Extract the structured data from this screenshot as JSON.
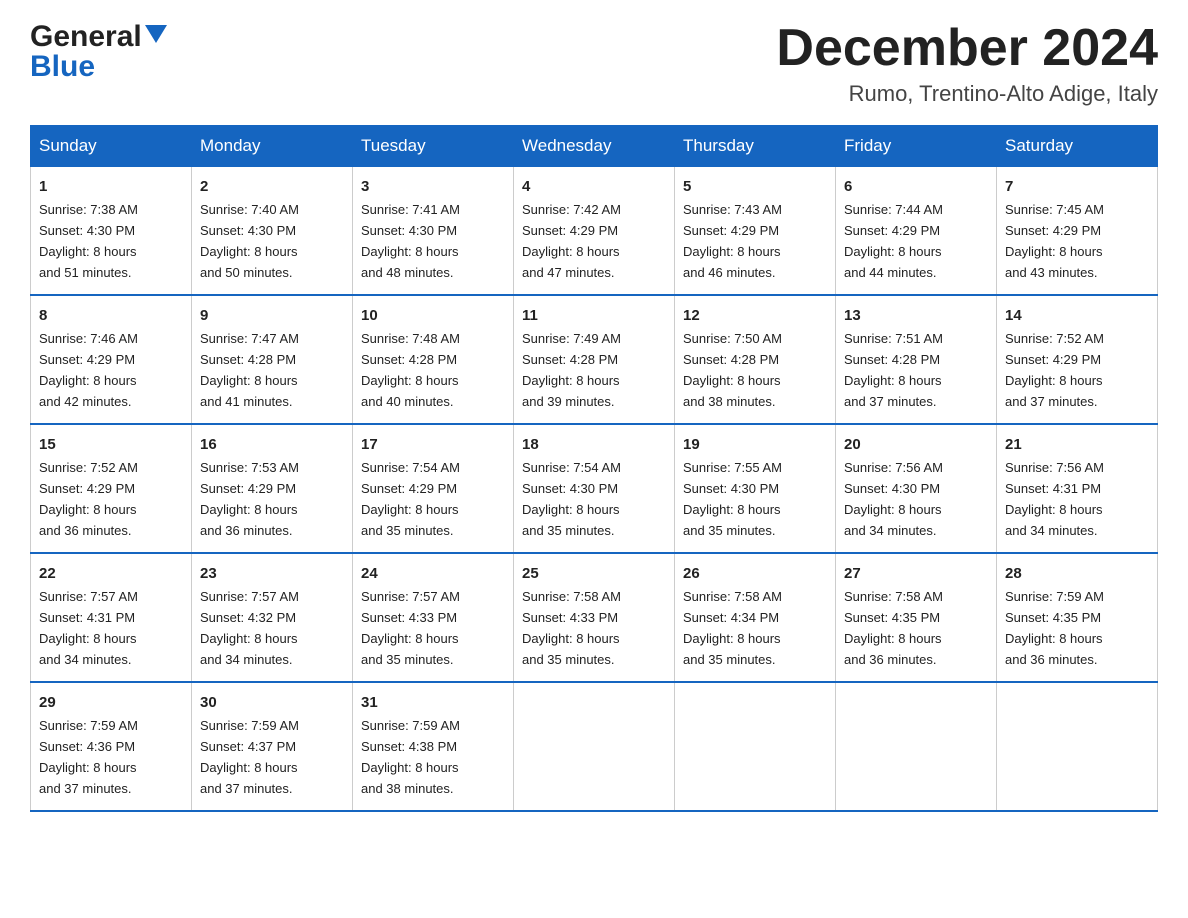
{
  "header": {
    "logo_general": "General",
    "logo_blue": "Blue",
    "month": "December 2024",
    "location": "Rumo, Trentino-Alto Adige, Italy"
  },
  "days_of_week": [
    "Sunday",
    "Monday",
    "Tuesday",
    "Wednesday",
    "Thursday",
    "Friday",
    "Saturday"
  ],
  "weeks": [
    [
      {
        "num": "1",
        "sunrise": "7:38 AM",
        "sunset": "4:30 PM",
        "daylight": "8 hours and 51 minutes."
      },
      {
        "num": "2",
        "sunrise": "7:40 AM",
        "sunset": "4:30 PM",
        "daylight": "8 hours and 50 minutes."
      },
      {
        "num": "3",
        "sunrise": "7:41 AM",
        "sunset": "4:30 PM",
        "daylight": "8 hours and 48 minutes."
      },
      {
        "num": "4",
        "sunrise": "7:42 AM",
        "sunset": "4:29 PM",
        "daylight": "8 hours and 47 minutes."
      },
      {
        "num": "5",
        "sunrise": "7:43 AM",
        "sunset": "4:29 PM",
        "daylight": "8 hours and 46 minutes."
      },
      {
        "num": "6",
        "sunrise": "7:44 AM",
        "sunset": "4:29 PM",
        "daylight": "8 hours and 44 minutes."
      },
      {
        "num": "7",
        "sunrise": "7:45 AM",
        "sunset": "4:29 PM",
        "daylight": "8 hours and 43 minutes."
      }
    ],
    [
      {
        "num": "8",
        "sunrise": "7:46 AM",
        "sunset": "4:29 PM",
        "daylight": "8 hours and 42 minutes."
      },
      {
        "num": "9",
        "sunrise": "7:47 AM",
        "sunset": "4:28 PM",
        "daylight": "8 hours and 41 minutes."
      },
      {
        "num": "10",
        "sunrise": "7:48 AM",
        "sunset": "4:28 PM",
        "daylight": "8 hours and 40 minutes."
      },
      {
        "num": "11",
        "sunrise": "7:49 AM",
        "sunset": "4:28 PM",
        "daylight": "8 hours and 39 minutes."
      },
      {
        "num": "12",
        "sunrise": "7:50 AM",
        "sunset": "4:28 PM",
        "daylight": "8 hours and 38 minutes."
      },
      {
        "num": "13",
        "sunrise": "7:51 AM",
        "sunset": "4:28 PM",
        "daylight": "8 hours and 37 minutes."
      },
      {
        "num": "14",
        "sunrise": "7:52 AM",
        "sunset": "4:29 PM",
        "daylight": "8 hours and 37 minutes."
      }
    ],
    [
      {
        "num": "15",
        "sunrise": "7:52 AM",
        "sunset": "4:29 PM",
        "daylight": "8 hours and 36 minutes."
      },
      {
        "num": "16",
        "sunrise": "7:53 AM",
        "sunset": "4:29 PM",
        "daylight": "8 hours and 36 minutes."
      },
      {
        "num": "17",
        "sunrise": "7:54 AM",
        "sunset": "4:29 PM",
        "daylight": "8 hours and 35 minutes."
      },
      {
        "num": "18",
        "sunrise": "7:54 AM",
        "sunset": "4:30 PM",
        "daylight": "8 hours and 35 minutes."
      },
      {
        "num": "19",
        "sunrise": "7:55 AM",
        "sunset": "4:30 PM",
        "daylight": "8 hours and 35 minutes."
      },
      {
        "num": "20",
        "sunrise": "7:56 AM",
        "sunset": "4:30 PM",
        "daylight": "8 hours and 34 minutes."
      },
      {
        "num": "21",
        "sunrise": "7:56 AM",
        "sunset": "4:31 PM",
        "daylight": "8 hours and 34 minutes."
      }
    ],
    [
      {
        "num": "22",
        "sunrise": "7:57 AM",
        "sunset": "4:31 PM",
        "daylight": "8 hours and 34 minutes."
      },
      {
        "num": "23",
        "sunrise": "7:57 AM",
        "sunset": "4:32 PM",
        "daylight": "8 hours and 34 minutes."
      },
      {
        "num": "24",
        "sunrise": "7:57 AM",
        "sunset": "4:33 PM",
        "daylight": "8 hours and 35 minutes."
      },
      {
        "num": "25",
        "sunrise": "7:58 AM",
        "sunset": "4:33 PM",
        "daylight": "8 hours and 35 minutes."
      },
      {
        "num": "26",
        "sunrise": "7:58 AM",
        "sunset": "4:34 PM",
        "daylight": "8 hours and 35 minutes."
      },
      {
        "num": "27",
        "sunrise": "7:58 AM",
        "sunset": "4:35 PM",
        "daylight": "8 hours and 36 minutes."
      },
      {
        "num": "28",
        "sunrise": "7:59 AM",
        "sunset": "4:35 PM",
        "daylight": "8 hours and 36 minutes."
      }
    ],
    [
      {
        "num": "29",
        "sunrise": "7:59 AM",
        "sunset": "4:36 PM",
        "daylight": "8 hours and 37 minutes."
      },
      {
        "num": "30",
        "sunrise": "7:59 AM",
        "sunset": "4:37 PM",
        "daylight": "8 hours and 37 minutes."
      },
      {
        "num": "31",
        "sunrise": "7:59 AM",
        "sunset": "4:38 PM",
        "daylight": "8 hours and 38 minutes."
      },
      null,
      null,
      null,
      null
    ]
  ],
  "labels": {
    "sunrise": "Sunrise:",
    "sunset": "Sunset:",
    "daylight": "Daylight:"
  }
}
